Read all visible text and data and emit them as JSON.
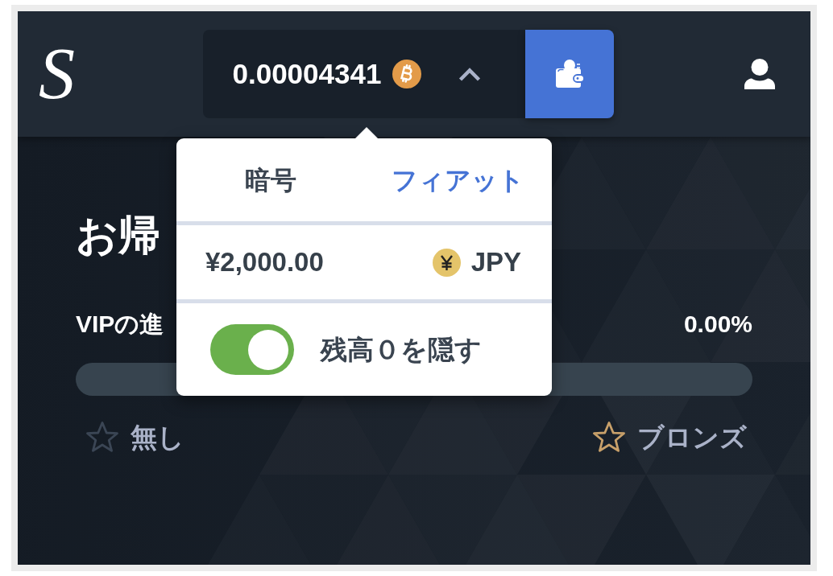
{
  "header": {
    "logo": "S",
    "balance": {
      "amount": "0.00004341",
      "expanded": true
    }
  },
  "balance_menu": {
    "tabs": [
      {
        "label": "暗号",
        "selected": false
      },
      {
        "label": "フィアット",
        "selected": true
      }
    ],
    "fiat": {
      "amount": "¥2,000.00",
      "currency": "JPY"
    },
    "hide_zero": {
      "label": "残高０を隠す",
      "on": true
    }
  },
  "welcome": {
    "title": "お帰"
  },
  "vip": {
    "label": "VIPの進",
    "percent": "0.00%",
    "level": 0,
    "tiers": [
      {
        "name": "無し",
        "color": "#3b4655"
      },
      {
        "name": "ブロンズ",
        "color": "#c8a06a"
      }
    ]
  }
}
